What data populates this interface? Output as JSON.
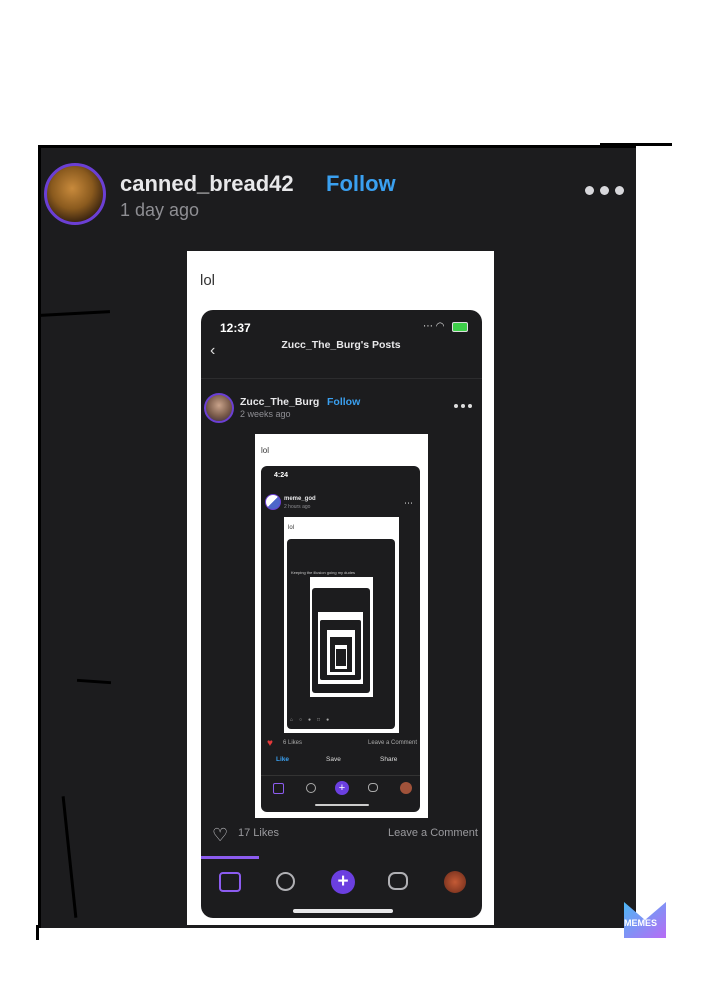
{
  "post": {
    "username": "canned_bread42",
    "follow_label": "Follow",
    "time_ago": "1 day ago",
    "caption": "lol",
    "likes": "17 Likes",
    "leave_comment": "Leave a Comment"
  },
  "screenshot": {
    "time": "12:37",
    "title": "Zucc_The_Burg's Posts",
    "username": "Zucc_The_Burg",
    "follow_label": "Follow",
    "time_ago": "2 weeks ago",
    "caption": "lol"
  },
  "nested": {
    "time": "4:24",
    "username": "meme_god",
    "time_ago": "2 hours ago",
    "caption": "lol",
    "likes": "6 Likes",
    "leave_comment": "Leave a Comment",
    "like_label": "Like",
    "save_label": "Save",
    "share_label": "Share",
    "inner_text": "Keeping the illusion going my dudes"
  },
  "icons": {
    "more": "more-dots-icon",
    "home": "home-icon",
    "search": "search-icon",
    "add": "plus-icon",
    "chat": "chat-icon",
    "profile": "profile-avatar-icon",
    "heart": "heart-icon"
  },
  "watermark": {
    "text": "MEMES"
  },
  "colors": {
    "accent": "#8c5cf0",
    "follow": "#3aa0f0",
    "background": "#1c1c1e"
  }
}
